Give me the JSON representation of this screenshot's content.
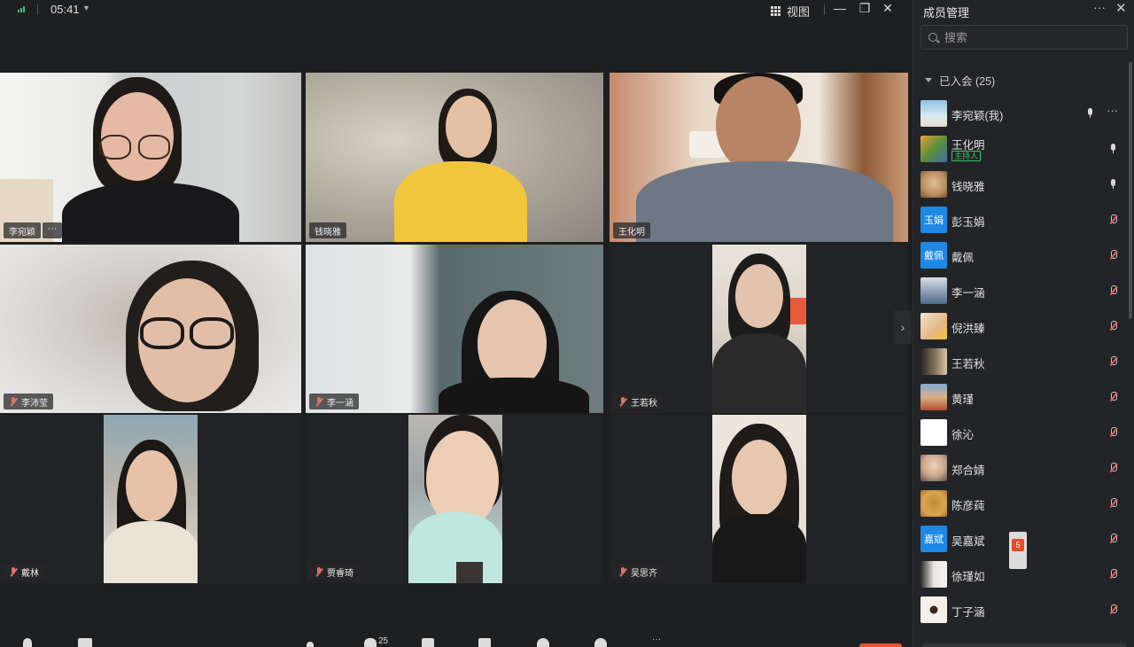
{
  "topbar": {
    "time": "05:41",
    "view_label": "视图",
    "colors": {
      "signal": "#3cc46a"
    }
  },
  "tiles": [
    {
      "name": "李宛颖",
      "muted": false,
      "active": true
    },
    {
      "name": "钱晓雅",
      "muted": false
    },
    {
      "name": "王化明",
      "muted": false
    },
    {
      "name": "李沛莹",
      "muted": true
    },
    {
      "name": "李一涵",
      "muted": true
    },
    {
      "name": "王若秋",
      "muted": true
    },
    {
      "name": "戴林",
      "muted": true
    },
    {
      "name": "贾睿琦",
      "muted": true
    },
    {
      "name": "吴思齐",
      "muted": true
    }
  ],
  "tile_more": "···",
  "toolbar": {
    "participants_count": "25",
    "colors": {
      "end": "#e8542c"
    }
  },
  "panel": {
    "title": "成员管理",
    "search_placeholder": "搜索",
    "section_label": "已入会 (25)",
    "host_badge": "主持人",
    "members": [
      {
        "name": "李宛颖(我)",
        "mic": "on",
        "avatar_text": ""
      },
      {
        "name": "王化明",
        "mic": "on",
        "avatar_text": "",
        "host": true
      },
      {
        "name": "钱晓雅",
        "mic": "on",
        "avatar_text": ""
      },
      {
        "name": "彭玉娟",
        "mic": "off",
        "avatar_text": "玉娟"
      },
      {
        "name": "戴佩",
        "mic": "off",
        "avatar_text": "戴佩"
      },
      {
        "name": "李一涵",
        "mic": "off",
        "avatar_text": ""
      },
      {
        "name": "倪洪臻",
        "mic": "off",
        "avatar_text": ""
      },
      {
        "name": "王若秋",
        "mic": "off",
        "avatar_text": ""
      },
      {
        "name": "黄瑾",
        "mic": "off",
        "avatar_text": ""
      },
      {
        "name": "徐沁",
        "mic": "off",
        "avatar_text": ""
      },
      {
        "name": "郑合婧",
        "mic": "off",
        "avatar_text": ""
      },
      {
        "name": "陈彦莼",
        "mic": "off",
        "avatar_text": ""
      },
      {
        "name": "吴嘉斌",
        "mic": "off",
        "avatar_text": "嘉斌"
      },
      {
        "name": "徐瑾如",
        "mic": "off",
        "avatar_text": ""
      },
      {
        "name": "丁子涵",
        "mic": "off",
        "avatar_text": ""
      }
    ],
    "colors": {
      "host_badge": "#3cc46a",
      "muted": "#e06060",
      "blue_avatar": "#1e88e5"
    }
  }
}
